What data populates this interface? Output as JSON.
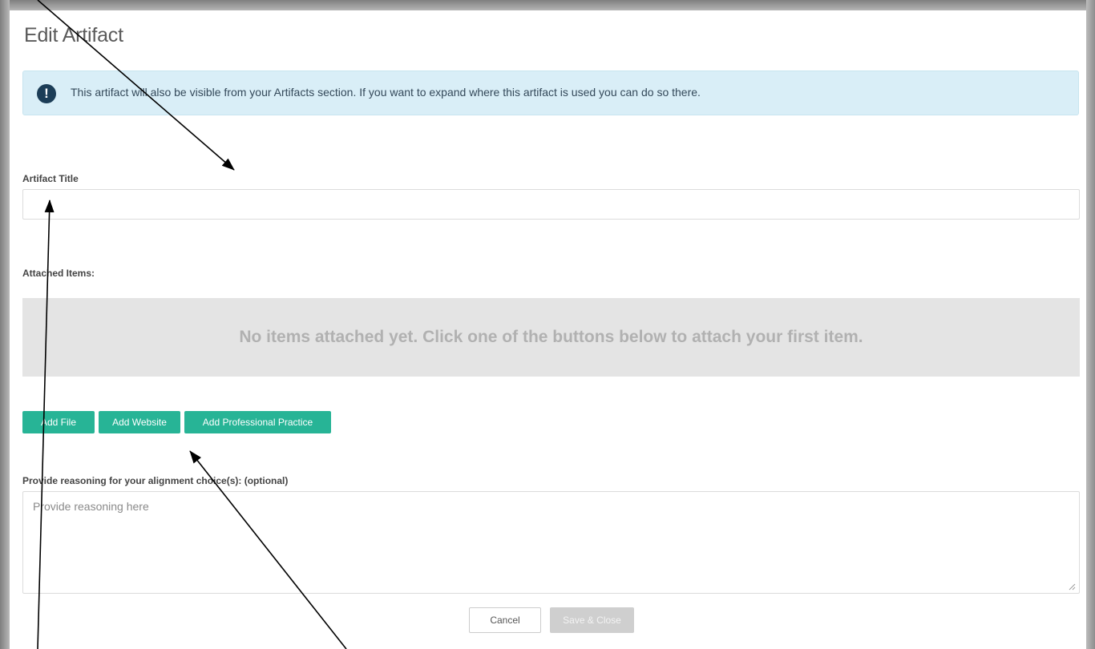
{
  "modal": {
    "title": "Edit Artifact"
  },
  "alert": {
    "icon_glyph": "!",
    "icon": "exclamation-circle-icon",
    "text": "This artifact will also be visible from your Artifacts section. If you want to expand where this artifact is used you can do so there."
  },
  "artifact_title": {
    "label": "Artifact Title",
    "value": ""
  },
  "attached_items": {
    "label": "Attached Items:",
    "empty_message": "No items attached yet. Click one of the buttons below to attach your first item."
  },
  "attach_buttons": {
    "add_file": "Add File",
    "add_website": "Add Website",
    "add_professional_practice": "Add Professional Practice"
  },
  "reasoning": {
    "label": "Provide reasoning for your alignment choice(s): (optional)",
    "placeholder": "Provide reasoning here",
    "value": ""
  },
  "footer": {
    "cancel_label": "Cancel",
    "save_label": "Save & Close"
  },
  "colors": {
    "accent_green": "#27b496",
    "alert_bg": "#d9eef7",
    "disabled_button": "#cfcfcf"
  }
}
